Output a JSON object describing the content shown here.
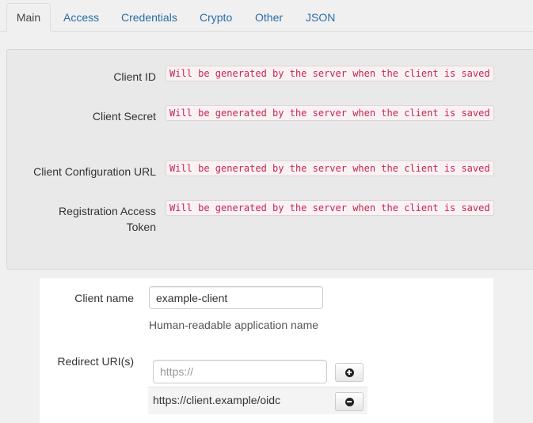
{
  "tabs": [
    {
      "label": "Main",
      "active": true
    },
    {
      "label": "Access"
    },
    {
      "label": "Credentials"
    },
    {
      "label": "Crypto"
    },
    {
      "label": "Other"
    },
    {
      "label": "JSON"
    }
  ],
  "generated": {
    "client_id_label": "Client ID",
    "client_secret_label": "Client Secret",
    "config_url_label": "Client Configuration URL",
    "rat_label_line1": "Registration Access",
    "rat_label_line2": "Token",
    "placeholder_text": "Will be generated by the server when the client is saved"
  },
  "form": {
    "client_name_label": "Client name",
    "client_name_value": "example-client",
    "client_name_help": "Human-readable application name",
    "redirect_label": "Redirect URI(s)",
    "redirect_placeholder": "https://",
    "redirect_uris": [
      "https://client.example/oidc"
    ]
  },
  "icons": {
    "add": "plus-circle-icon",
    "remove": "minus-circle-icon"
  }
}
